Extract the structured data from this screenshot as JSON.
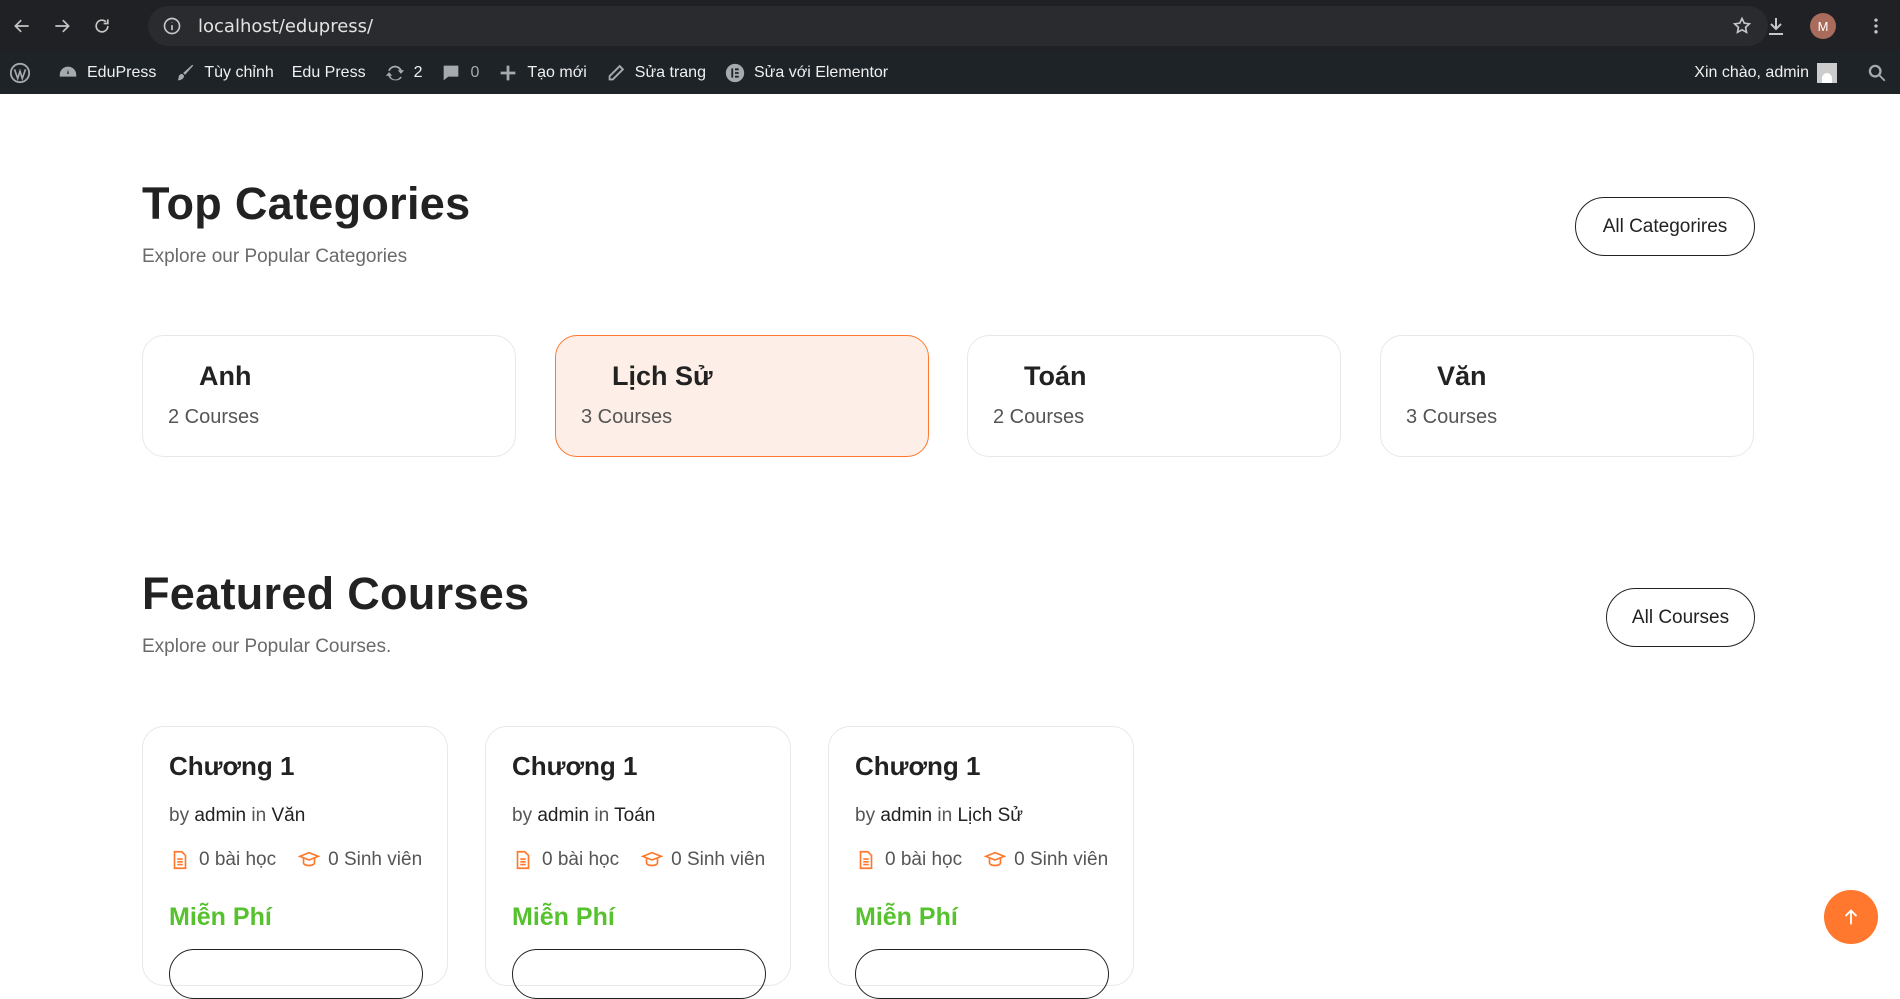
{
  "browser": {
    "url": "localhost/edupress/",
    "profile_initial": "M"
  },
  "admin_bar": {
    "site_name": "EduPress",
    "customize": "Tùy chỉnh",
    "theme": "Edu Press",
    "updates_count": "2",
    "comments_count": "0",
    "new": "Tạo mới",
    "edit_page": "Sửa trang",
    "edit_elementor": "Sửa với Elementor",
    "greeting": "Xin chào, admin"
  },
  "categories": {
    "title": "Top Categories",
    "subtitle": "Explore our Popular Categories",
    "all_button": "All Categorires",
    "items": [
      {
        "name": "Anh",
        "count": "2 Courses"
      },
      {
        "name": "Lịch Sử",
        "count": "3 Courses"
      },
      {
        "name": "Toán",
        "count": "2 Courses"
      },
      {
        "name": "Văn",
        "count": "3 Courses"
      }
    ]
  },
  "courses": {
    "title": "Featured Courses",
    "subtitle": "Explore our Popular Courses.",
    "all_button": "All Courses",
    "items": [
      {
        "title": "Chương 1",
        "by": "by",
        "author": "admin",
        "in": "in",
        "category": "Văn",
        "lessons": "0 bài học",
        "students": "0 Sinh viên",
        "price": "Miễn Phí"
      },
      {
        "title": "Chương 1",
        "by": "by",
        "author": "admin",
        "in": "in",
        "category": "Toán",
        "lessons": "0 bài học",
        "students": "0 Sinh viên",
        "price": "Miễn Phí"
      },
      {
        "title": "Chương 1",
        "by": "by",
        "author": "admin",
        "in": "in",
        "category": "Lịch Sử",
        "lessons": "0 bài học",
        "students": "0 Sinh viên",
        "price": "Miễn Phí"
      }
    ]
  },
  "colors": {
    "accent": "#ff782d",
    "price_green": "#55c22e",
    "active_card_bg": "#fdefe7"
  }
}
